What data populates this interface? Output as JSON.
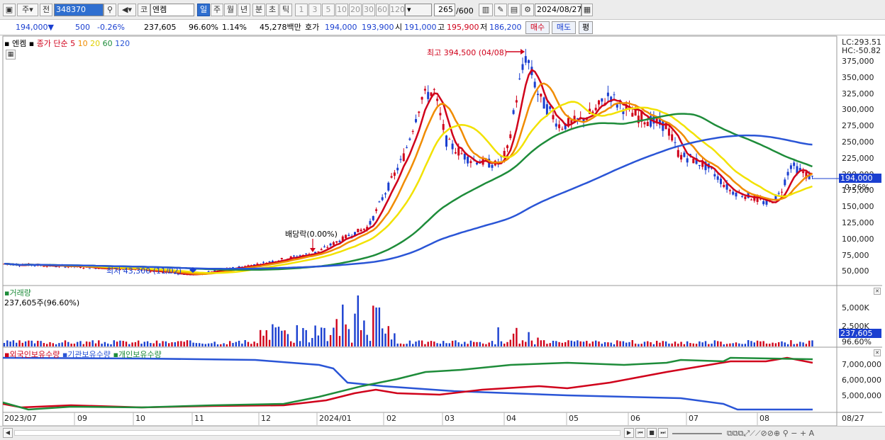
{
  "toolbar": {
    "market": "주",
    "prev": "전",
    "code": "348370",
    "name": "엔켐",
    "kosdaq": "코",
    "periods": [
      "일",
      "주",
      "월",
      "년",
      "분",
      "초",
      "틱"
    ],
    "minutes": [
      "1",
      "3",
      "5",
      "10",
      "20",
      "30",
      "60",
      "120"
    ],
    "count": "265",
    "total": "/600",
    "date": "2024/08/27"
  },
  "quote": {
    "price": "194,000",
    "arrow": "▼",
    "change": "500",
    "rate": "-0.26%",
    "volume": "237,605",
    "vol_rate": "96.60%",
    "turnover": "1.14%",
    "amount": "45,278백만",
    "bid_label": "호가",
    "bid1": "194,000",
    "bid2": "193,900",
    "open_label": "시",
    "open": "191,000",
    "high_label": "고",
    "high": "195,900",
    "low_label": "저",
    "low": "186,200",
    "buy": "매수",
    "sell": "매도",
    "avg": "평"
  },
  "legend": {
    "name": "엔켐",
    "ma_label": "종가 단순",
    "ma": [
      "5",
      "10",
      "20",
      "60",
      "120"
    ],
    "ma_colors": [
      "#d0021b",
      "#f08c00",
      "#f2e200",
      "#1e8c3a",
      "#2a55d6"
    ]
  },
  "annotations": {
    "high": "최고 394,500 (04/08)",
    "low": "최저 43,300 (11/02)",
    "dividend": "배당락(0.00%)"
  },
  "yaxis": {
    "lc": "LC:293.51",
    "hc": "HC:-50.82",
    "ticks": [
      "375,000",
      "350,000",
      "325,000",
      "300,000",
      "275,000",
      "250,000",
      "225,000",
      "200,000",
      "175,000",
      "150,000",
      "125,000",
      "100,000",
      "75,000",
      "50,000"
    ],
    "last": "194,000",
    "last_rate": "-0.26%"
  },
  "volume_panel": {
    "title": "거래량",
    "current": "237,605주(96.60%)",
    "ticks": [
      "5,000K",
      "2,500K"
    ],
    "last": "237,605",
    "last_rate": "96.60%"
  },
  "holdings_panel": {
    "series": [
      "외국인보유수량",
      "기관보유수량",
      "개인보유수량"
    ],
    "colors": [
      "#d0021b",
      "#2a55d6",
      "#1e8c3a"
    ],
    "ticks": [
      "7,000,000",
      "6,000,000",
      "5,000,000"
    ]
  },
  "xaxis": [
    "2023/07",
    "09",
    "10",
    "11",
    "12",
    "2024/01",
    "02",
    "03",
    "04",
    "05",
    "06",
    "07",
    "08",
    "08/27"
  ],
  "chart_data": {
    "type": "line",
    "title": "엔켐",
    "x": [
      "2023/07",
      "2023/09",
      "2023/10",
      "2023/11",
      "2023/12",
      "2024/01",
      "2024/02",
      "2024/03",
      "2024/04",
      "2024/05",
      "2024/06",
      "2024/07",
      "2024/08",
      "2024/08/27"
    ],
    "series": [
      {
        "name": "종가",
        "values": [
          60000,
          55000,
          50000,
          45000,
          62000,
          75000,
          120000,
          250000,
          330000,
          280000,
          300000,
          230000,
          165000,
          194000
        ]
      },
      {
        "name": "120",
        "values": [
          68000,
          66000,
          62000,
          58000,
          58000,
          62000,
          75000,
          120000,
          170000,
          210000,
          240000,
          262000,
          260000,
          248000
        ]
      }
    ],
    "ylim": [
      25000,
      400000
    ]
  }
}
